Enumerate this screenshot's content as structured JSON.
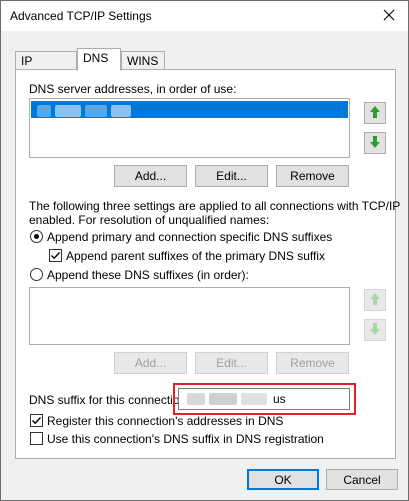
{
  "window": {
    "title": "Advanced TCP/IP Settings",
    "close_glyph": "✕"
  },
  "tabs": [
    {
      "label": "IP Settings",
      "active": false
    },
    {
      "label": "DNS",
      "active": true
    },
    {
      "label": "WINS",
      "active": false
    }
  ],
  "dns_servers": {
    "label": "DNS server addresses, in order of use:",
    "selected_entry": "",
    "buttons": {
      "add": "Add...",
      "edit": "Edit...",
      "remove": "Remove"
    }
  },
  "resolution": {
    "description": "The following three settings are applied to all connections with TCP/IP enabled. For resolution of unqualified names:",
    "line1": "The following three settings are applied to all connections with TCP/IP",
    "line2": "enabled. For resolution of unqualified names:",
    "option_primary": {
      "label": "Append primary and connection specific DNS suffixes",
      "checked": true
    },
    "option_parent": {
      "label": "Append parent suffixes of the primary DNS suffix",
      "checked": true
    },
    "option_these": {
      "label": "Append these DNS suffixes (in order):",
      "checked": false
    }
  },
  "suffix_list": {
    "buttons": {
      "add": "Add...",
      "edit": "Edit...",
      "remove": "Remove"
    }
  },
  "connection_suffix": {
    "label": "DNS suffix for this connection:",
    "value": "us"
  },
  "register": {
    "label": "Register this connection's addresses in DNS",
    "checked": true
  },
  "use_suffix": {
    "label": "Use this connection's DNS suffix in DNS registration",
    "checked": false
  },
  "footer": {
    "ok": "OK",
    "cancel": "Cancel"
  },
  "colors": {
    "selection": "#0078d7",
    "highlight": "#e0202a",
    "arrow_enabled": "#2e9e2e",
    "arrow_disabled": "#a8d8a8"
  }
}
